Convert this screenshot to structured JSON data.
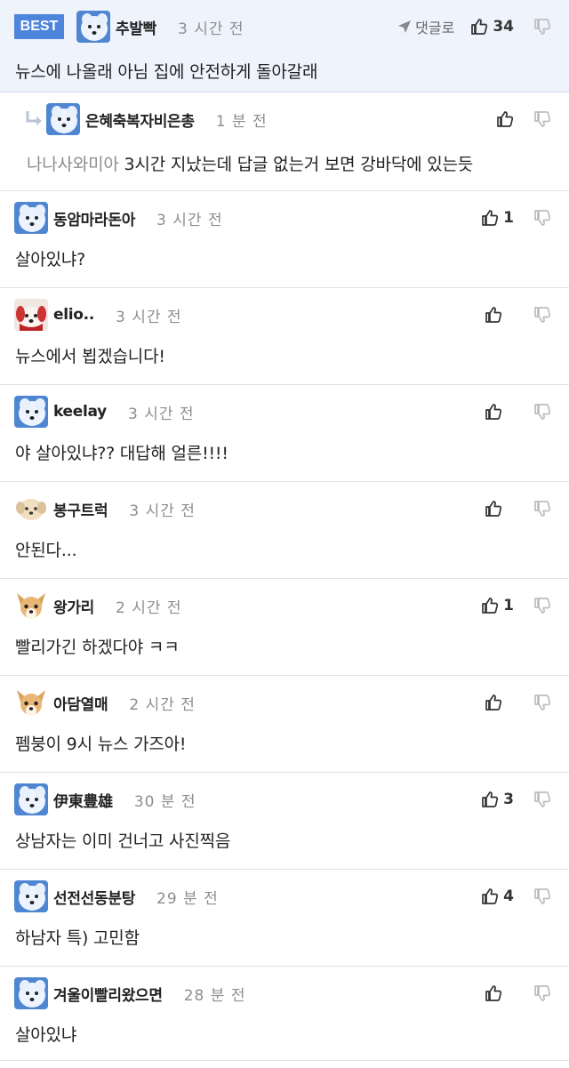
{
  "best_comment": {
    "badge": "BEST",
    "nickname": "추발빡",
    "time": "3 시간 전",
    "reply_label": "댓글로",
    "likes": "34",
    "body": "뉴스에 나올래 아님 집에 안전하게 돌아갈래",
    "avatar": "white-dog-avatar"
  },
  "reply_comment": {
    "nickname": "은혜축복자비은총",
    "time": "1 분 전",
    "mention": "나나사와미아",
    "body": " 3시간 지났는데 답글 없는거 보면 강바닥에 있는듯",
    "avatar": "white-dog-avatar"
  },
  "comments": [
    {
      "nickname": "동암마라돈아",
      "time": "3 시간 전",
      "likes": "1",
      "body": "살아있냐?",
      "avatar": "white-dog-avatar"
    },
    {
      "nickname": "elio..",
      "time": "3 시간 전",
      "likes": "",
      "body": "뉴스에서 뵙겠습니다!",
      "avatar": "red-dog-avatar"
    },
    {
      "nickname": "keelay",
      "time": "3 시간 전",
      "likes": "",
      "body": "야 살아있냐?? 대답해 얼른!!!!",
      "avatar": "white-dog-avatar"
    },
    {
      "nickname": "봉구트럭",
      "time": "3 시간 전",
      "likes": "",
      "body": "안된다...",
      "avatar": "puppy-avatar"
    },
    {
      "nickname": "왕가리",
      "time": "2 시간 전",
      "likes": "1",
      "body": "빨리가긴 하겠다야 ㅋㅋ",
      "avatar": "chihuahua-avatar"
    },
    {
      "nickname": "아담열매",
      "time": "2 시간 전",
      "likes": "",
      "body": "펨붕이 9시 뉴스 가즈아!",
      "avatar": "chihuahua-avatar"
    },
    {
      "nickname": "伊東豊雄",
      "time": "30 분 전",
      "likes": "3",
      "body": "상남자는 이미 건너고 사진찍음",
      "avatar": "white-dog-avatar"
    },
    {
      "nickname": "선전선동분탕",
      "time": "29 분 전",
      "likes": "4",
      "body": "하남자 특) 고민함",
      "avatar": "white-dog-avatar"
    },
    {
      "nickname": "겨울이빨리왔으면",
      "time": "28 분 전",
      "likes": "",
      "body": "살아있냐",
      "avatar": "white-dog-avatar"
    }
  ],
  "colors": {
    "best_badge": "#4d85dc",
    "best_background": "#eef3fc",
    "time_text": "#8e8e8e",
    "mention_text": "#8d8d8d"
  }
}
